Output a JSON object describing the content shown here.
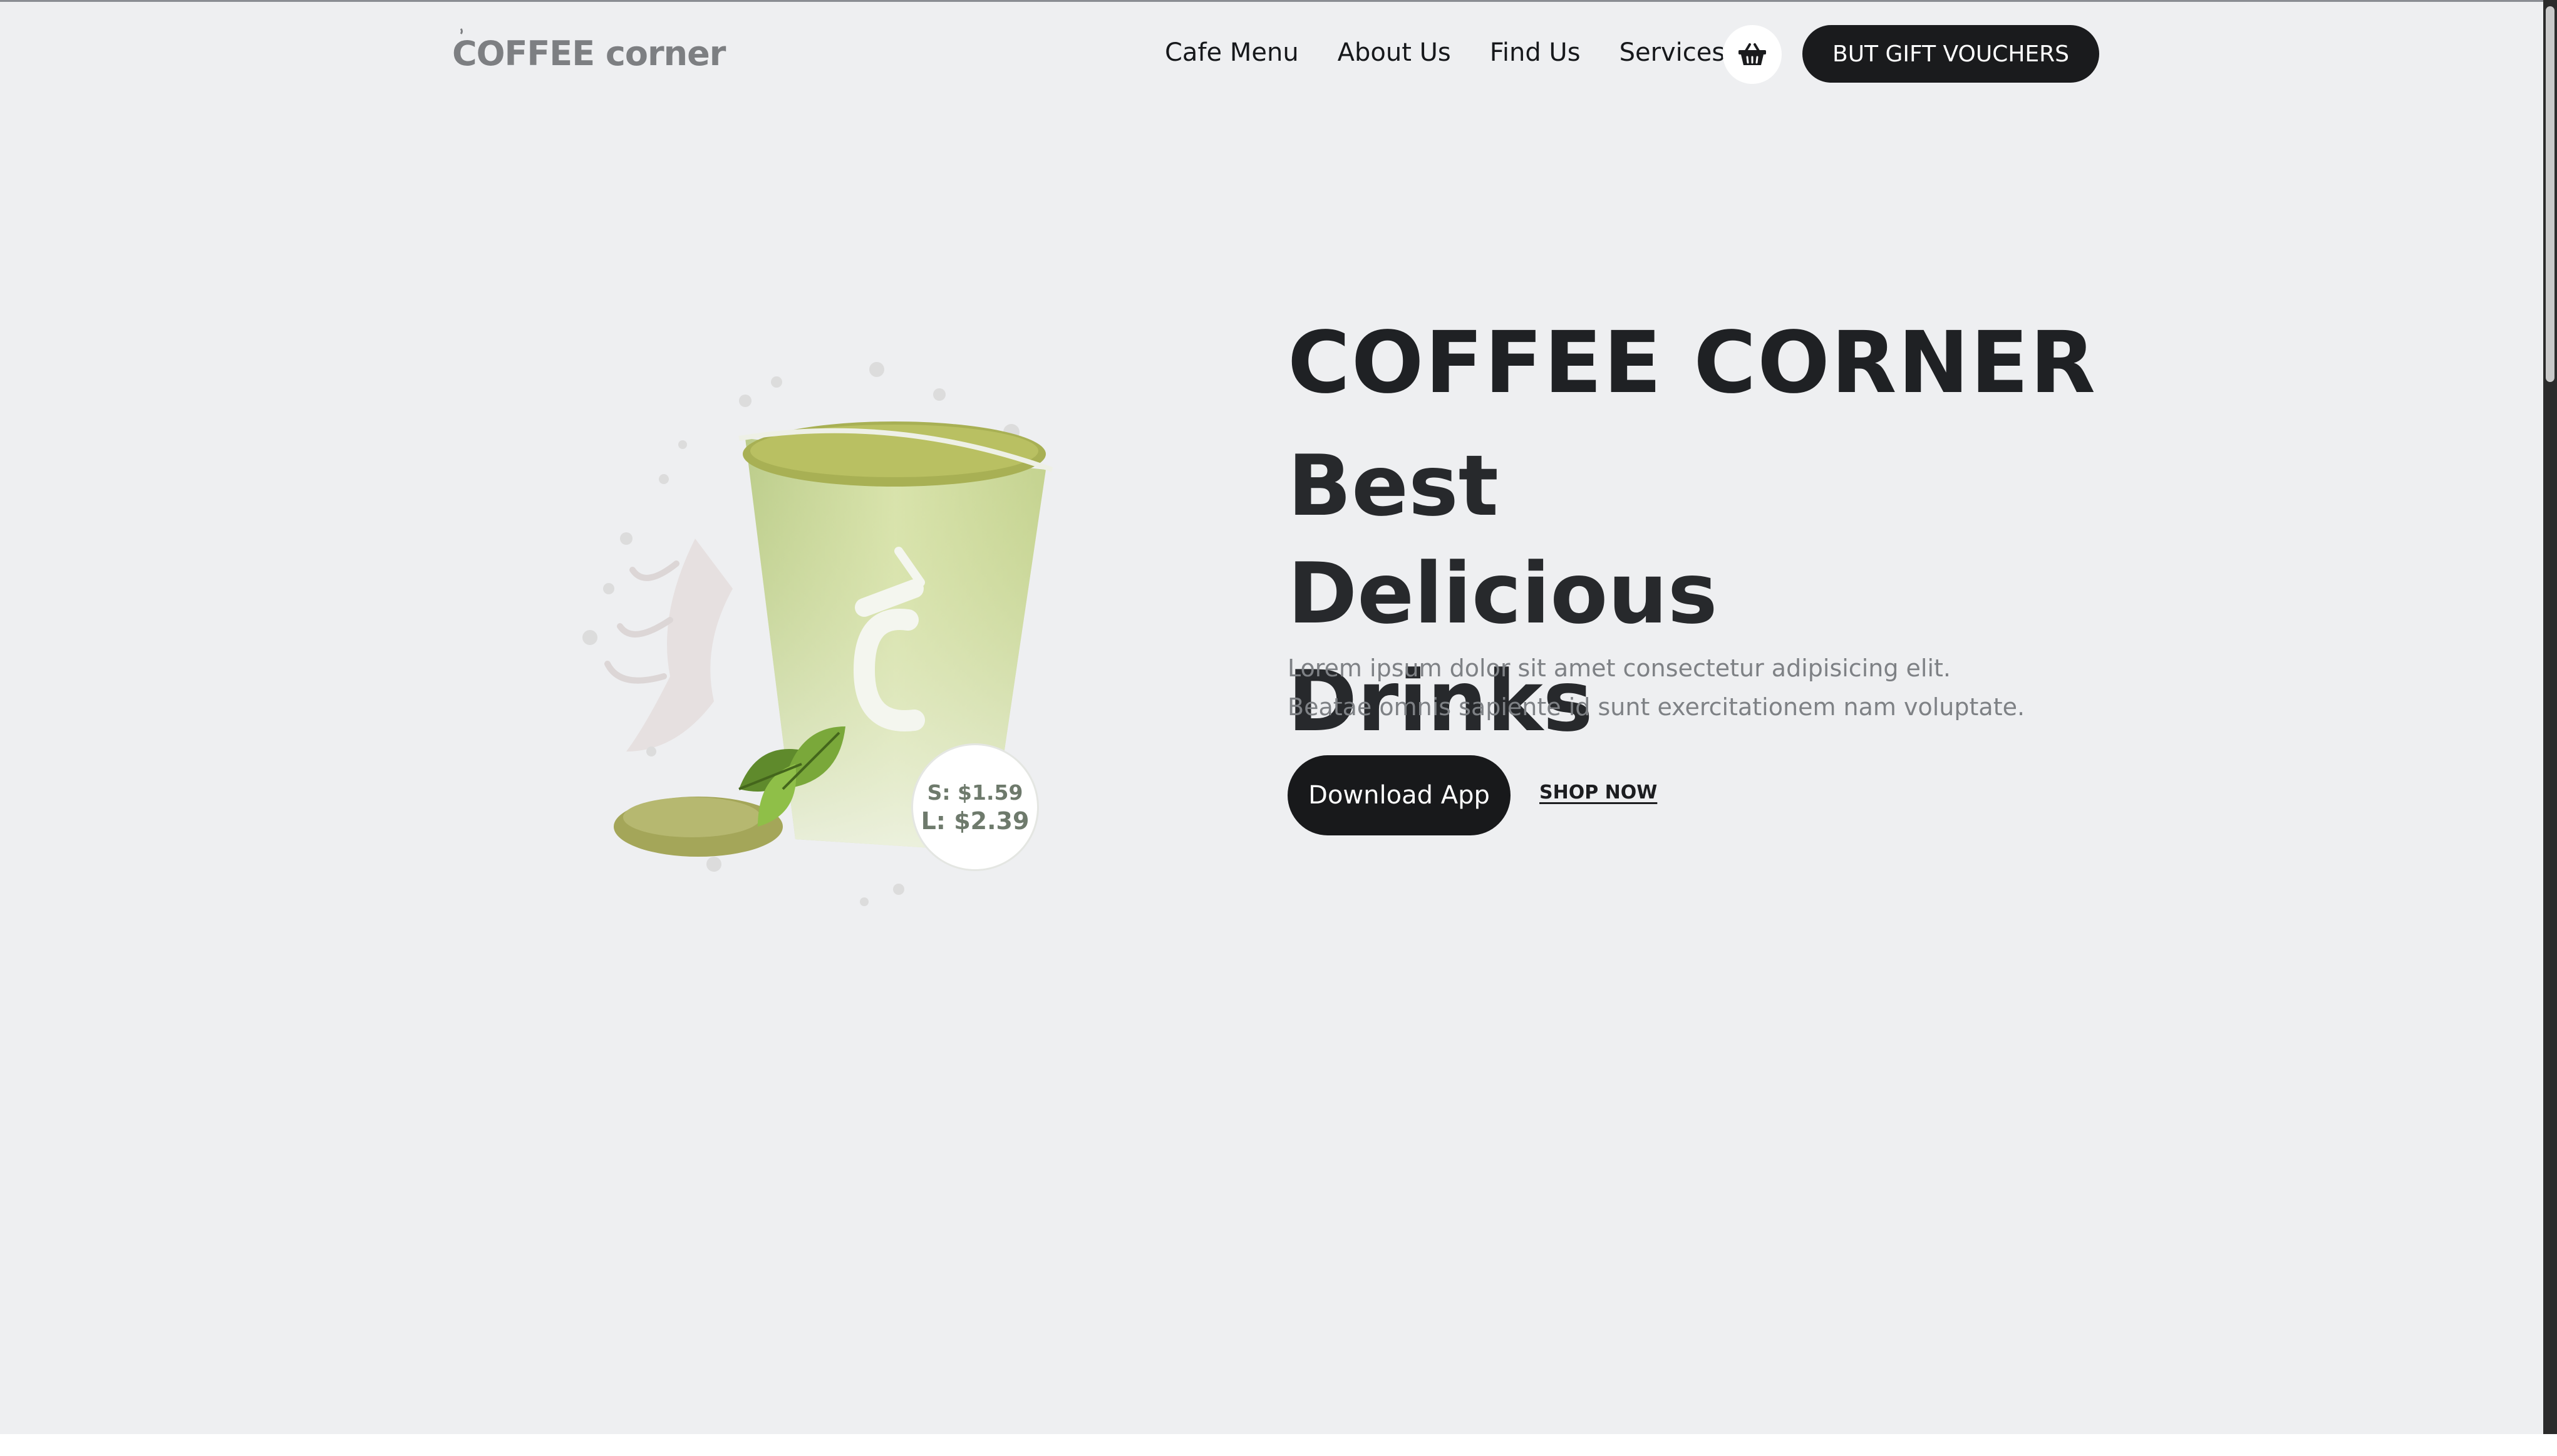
{
  "header": {
    "logo_text": "COFFEE corner",
    "nav": [
      "Cafe Menu",
      "About Us",
      "Find Us",
      "Services"
    ],
    "cart_icon": "basket-icon",
    "gift_button_label": "BUT GIFT VOUCHERS"
  },
  "hero": {
    "title": "COFFEE CORNER",
    "subtitle": "Best Delicious Drinks",
    "description": "Lorem ipsum dolor sit amet consectetur adipisicing elit. Beatae omnis sapiente id sunt exercitationem nam voluptate.",
    "download_button_label": "Download App",
    "shop_link_label": "SHOP NOW",
    "image": {
      "icon": "matcha-drink-image",
      "price_small": "S: $1.59",
      "price_large": "L: $2.39"
    }
  },
  "colors": {
    "background": "#eeeff1",
    "primary_button": "#1a1b1d",
    "heading": "#1f2124",
    "body_text": "#7e8185",
    "logo": "#7d7f82",
    "drink_green": "#c9d98c"
  }
}
